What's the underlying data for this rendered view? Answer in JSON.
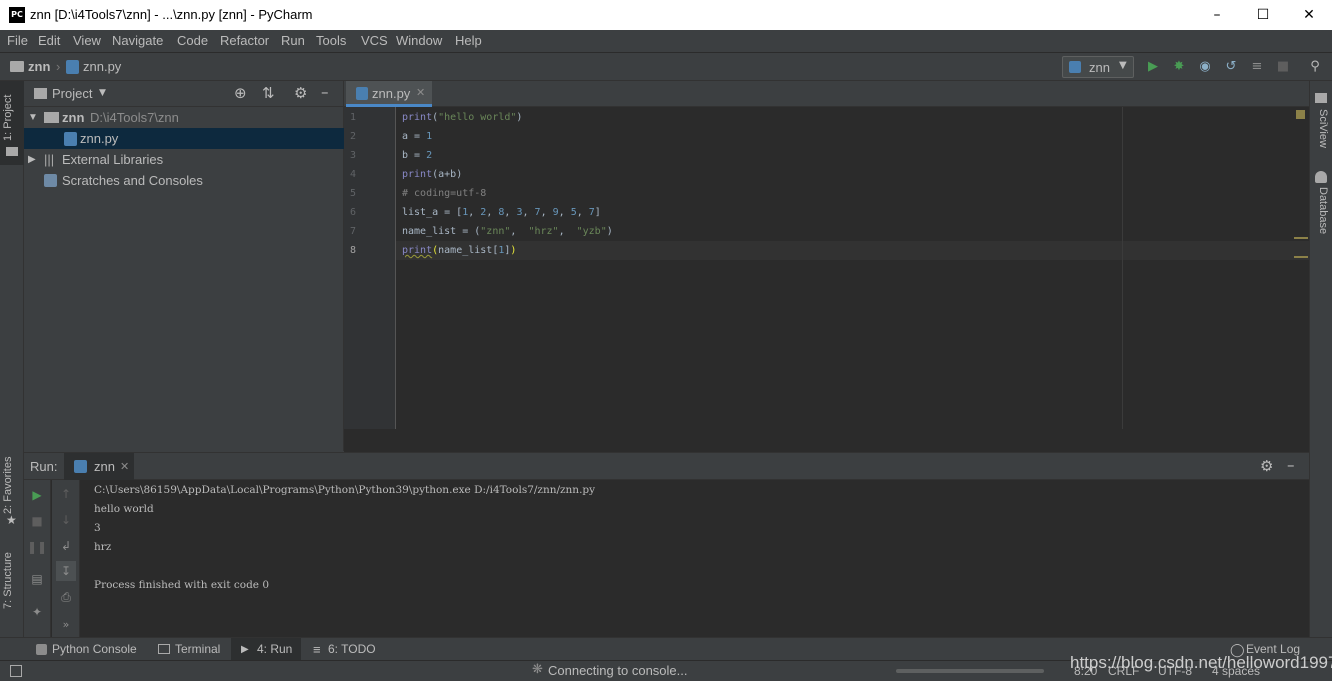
{
  "window": {
    "title": "znn [D:\\i4Tools7\\znn] - ...\\znn.py [znn] - PyCharm",
    "logo_text": "PC"
  },
  "menu": [
    "File",
    "Edit",
    "View",
    "Navigate",
    "Code",
    "Refactor",
    "Run",
    "Tools",
    "VCS",
    "Window",
    "Help"
  ],
  "nav": {
    "project": "znn",
    "file": "znn.py",
    "run_config": "znn"
  },
  "left_strip": {
    "project_tab": "1: Project",
    "favorites_tab": "2: Favorites",
    "structure_tab": "7: Structure"
  },
  "right_strip": {
    "sciview_tab": "SciView",
    "database_tab": "Database"
  },
  "project_panel": {
    "title": "Project",
    "tree": {
      "root_name": "znn",
      "root_path": "D:\\i4Tools7\\znn",
      "file": "znn.py",
      "libraries": "External Libraries",
      "scratches": "Scratches and Consoles"
    }
  },
  "editor": {
    "tab_label": "znn.py",
    "line_numbers": [
      "1",
      "2",
      "3",
      "4",
      "5",
      "6",
      "7",
      "8"
    ]
  },
  "run_panel": {
    "label": "Run:",
    "tab": "znn",
    "output": {
      "cmd": "C:\\Users\\86159\\AppData\\Local\\Programs\\Python\\Python39\\python.exe D:/i4Tools7/znn/znn.py",
      "l1": "hello world",
      "l2": "3",
      "l3": "hrz",
      "l4": "Process finished with exit code 0"
    }
  },
  "bottom_tabs": {
    "python_console": "Python Console",
    "terminal": "Terminal",
    "run": "4: Run",
    "todo": "6: TODO",
    "event_log": "Event Log"
  },
  "status": {
    "connecting": "Connecting to console...",
    "position": "8:20",
    "line_sep": "CRLF",
    "encoding": "UTF-8",
    "indent": "4 spaces",
    "watermark": "https://blog.csdn.net/helloword1997"
  },
  "colors": {
    "accent": "#4a88c7",
    "run_green": "#499c54"
  }
}
